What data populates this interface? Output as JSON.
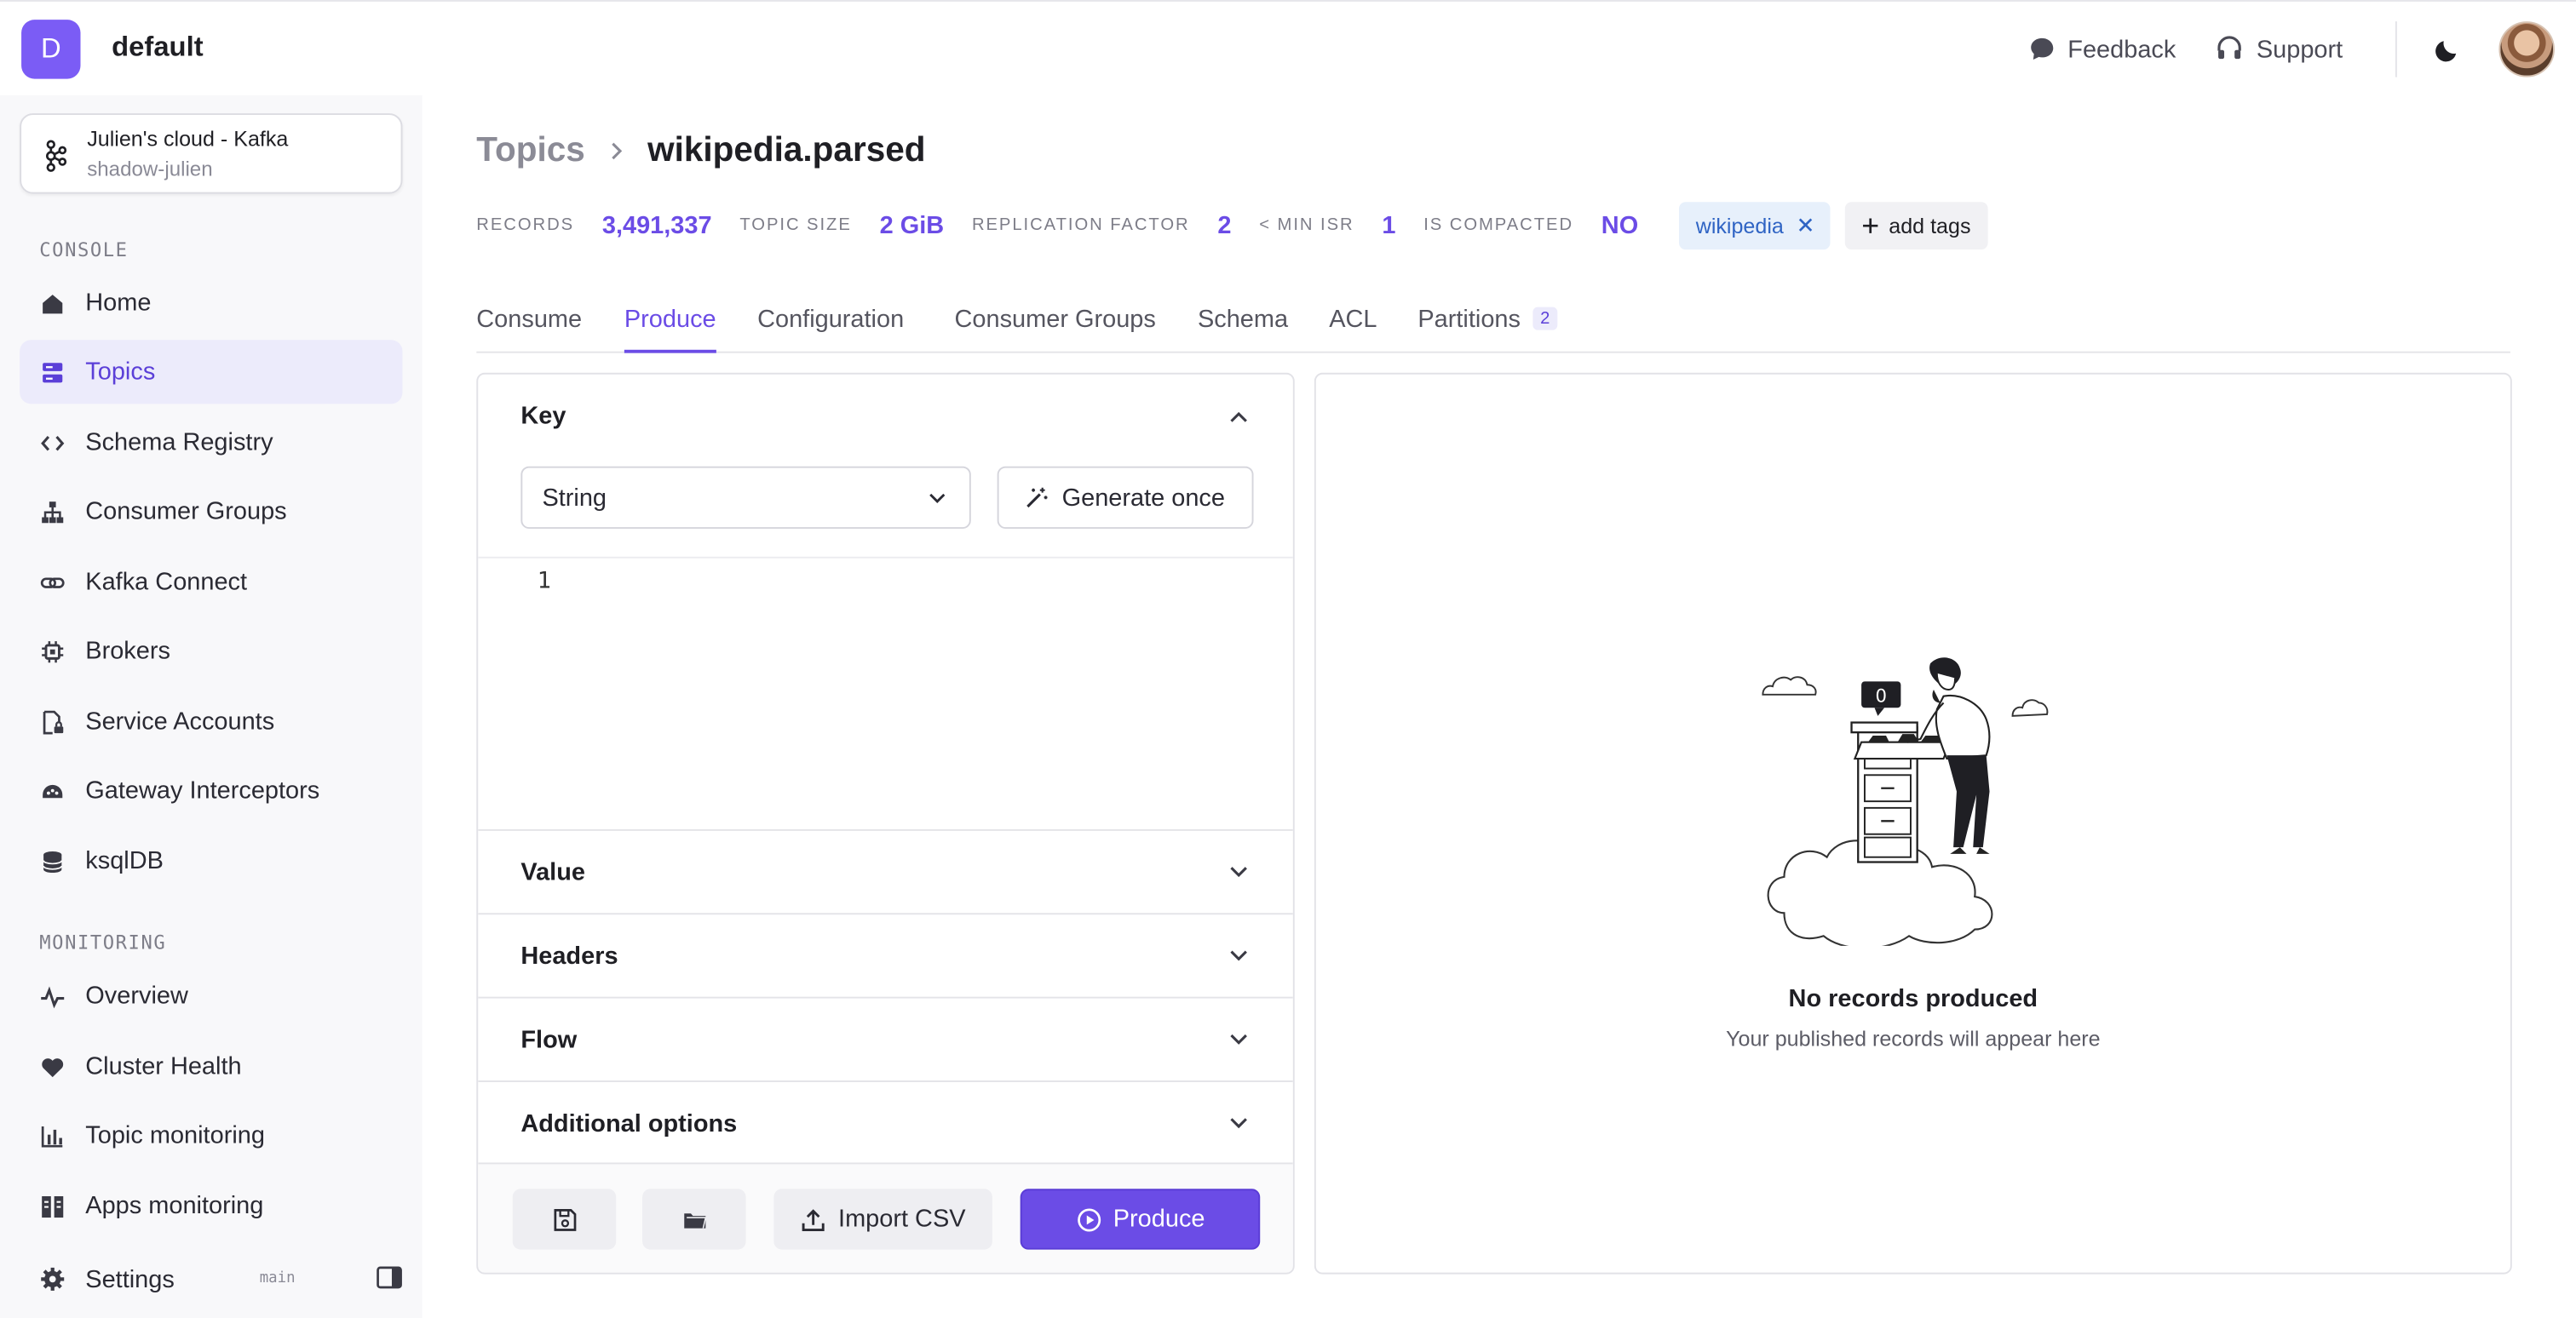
{
  "org": {
    "initial": "D",
    "name": "default"
  },
  "topbar": {
    "feedback": "Feedback",
    "support": "Support"
  },
  "cluster": {
    "name": "Julien's cloud - Kafka",
    "sub": "shadow-julien"
  },
  "sidebar": {
    "console_label": "CONSOLE",
    "console_items": [
      {
        "label": "Home",
        "icon": "home-icon"
      },
      {
        "label": "Topics",
        "icon": "topics-icon",
        "active": true
      },
      {
        "label": "Schema Registry",
        "icon": "code-icon"
      },
      {
        "label": "Consumer Groups",
        "icon": "hierarchy-icon"
      },
      {
        "label": "Kafka Connect",
        "icon": "link-icon"
      },
      {
        "label": "Brokers",
        "icon": "chip-icon"
      },
      {
        "label": "Service Accounts",
        "icon": "file-lock-icon"
      },
      {
        "label": "Gateway Interceptors",
        "icon": "gateway-icon"
      },
      {
        "label": "ksqlDB",
        "icon": "database-icon"
      }
    ],
    "monitoring_label": "MONITORING",
    "monitoring_items": [
      {
        "label": "Overview",
        "icon": "pulse-icon"
      },
      {
        "label": "Cluster Health",
        "icon": "heart-icon"
      },
      {
        "label": "Topic monitoring",
        "icon": "bar-chart-icon"
      },
      {
        "label": "Apps monitoring",
        "icon": "apps-icon"
      }
    ],
    "settings": "Settings",
    "branch": "main"
  },
  "breadcrumb": {
    "root": "Topics",
    "current": "wikipedia.parsed"
  },
  "stats": {
    "records_label": "RECORDS",
    "records": "3,491,337",
    "size_label": "TOPIC SIZE",
    "size": "2 GiB",
    "rf_label": "REPLICATION FACTOR",
    "rf": "2",
    "isr_label": "< MIN ISR",
    "isr": "1",
    "compacted_label": "IS COMPACTED",
    "compacted": "NO",
    "tag": "wikipedia",
    "add_tags": "add tags"
  },
  "tabs": {
    "consume": "Consume",
    "produce": "Produce",
    "configuration": "Configuration",
    "consumer_groups": "Consumer Groups",
    "schema": "Schema",
    "acl": "ACL",
    "partitions": "Partitions",
    "partitions_count": "2"
  },
  "produce": {
    "key_label": "Key",
    "key_type": "String",
    "generate": "Generate once",
    "line_number": "1",
    "value_label": "Value",
    "headers_label": "Headers",
    "flow_label": "Flow",
    "options_label": "Additional options",
    "import_csv": "Import CSV",
    "produce_btn": "Produce"
  },
  "records": {
    "illus_count": "0",
    "empty_title": "No records produced",
    "empty_sub": "Your published records will appear here"
  },
  "colors": {
    "accent": "#6b4ce6",
    "badge": "#7b5cf5",
    "tag_bg": "#e7f0fb"
  }
}
